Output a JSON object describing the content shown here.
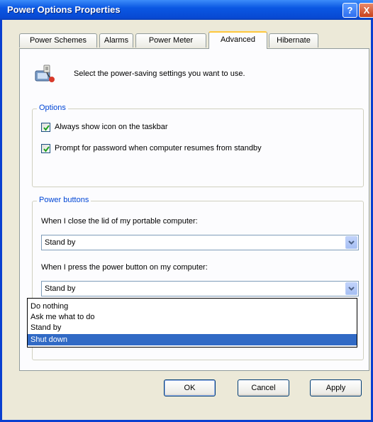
{
  "window": {
    "title": "Power Options Properties",
    "help_button": "?",
    "close_button": "X",
    "border_color": "#0a3fd0"
  },
  "tabs": [
    {
      "label": "Power Schemes",
      "active": false
    },
    {
      "label": "Alarms",
      "active": false
    },
    {
      "label": "Power Meter",
      "active": false
    },
    {
      "label": "Advanced",
      "active": true
    },
    {
      "label": "Hibernate",
      "active": false
    }
  ],
  "header": {
    "icon": "power-options-icon",
    "text": "Select the power-saving settings you want to use."
  },
  "options_group": {
    "legend": "Options",
    "checkboxes": [
      {
        "label": "Always show icon on the taskbar",
        "checked": true
      },
      {
        "label": "Prompt for password when computer resumes from standby",
        "checked": true
      }
    ]
  },
  "power_buttons_group": {
    "legend": "Power buttons",
    "lid_label": "When I close the lid of my portable computer:",
    "lid_value": "Stand by",
    "power_label": "When I press the power button on my computer:",
    "power_value": "Stand by",
    "dropdown_options": [
      "Do nothing",
      "Ask me what to do",
      "Stand by",
      "Shut down"
    ],
    "dropdown_highlighted": "Shut down"
  },
  "buttons": {
    "ok": "OK",
    "cancel": "Cancel",
    "apply": "Apply"
  },
  "colors": {
    "accent": "#0046d5",
    "selection": "#316ac5",
    "checkmark": "#21a121"
  }
}
